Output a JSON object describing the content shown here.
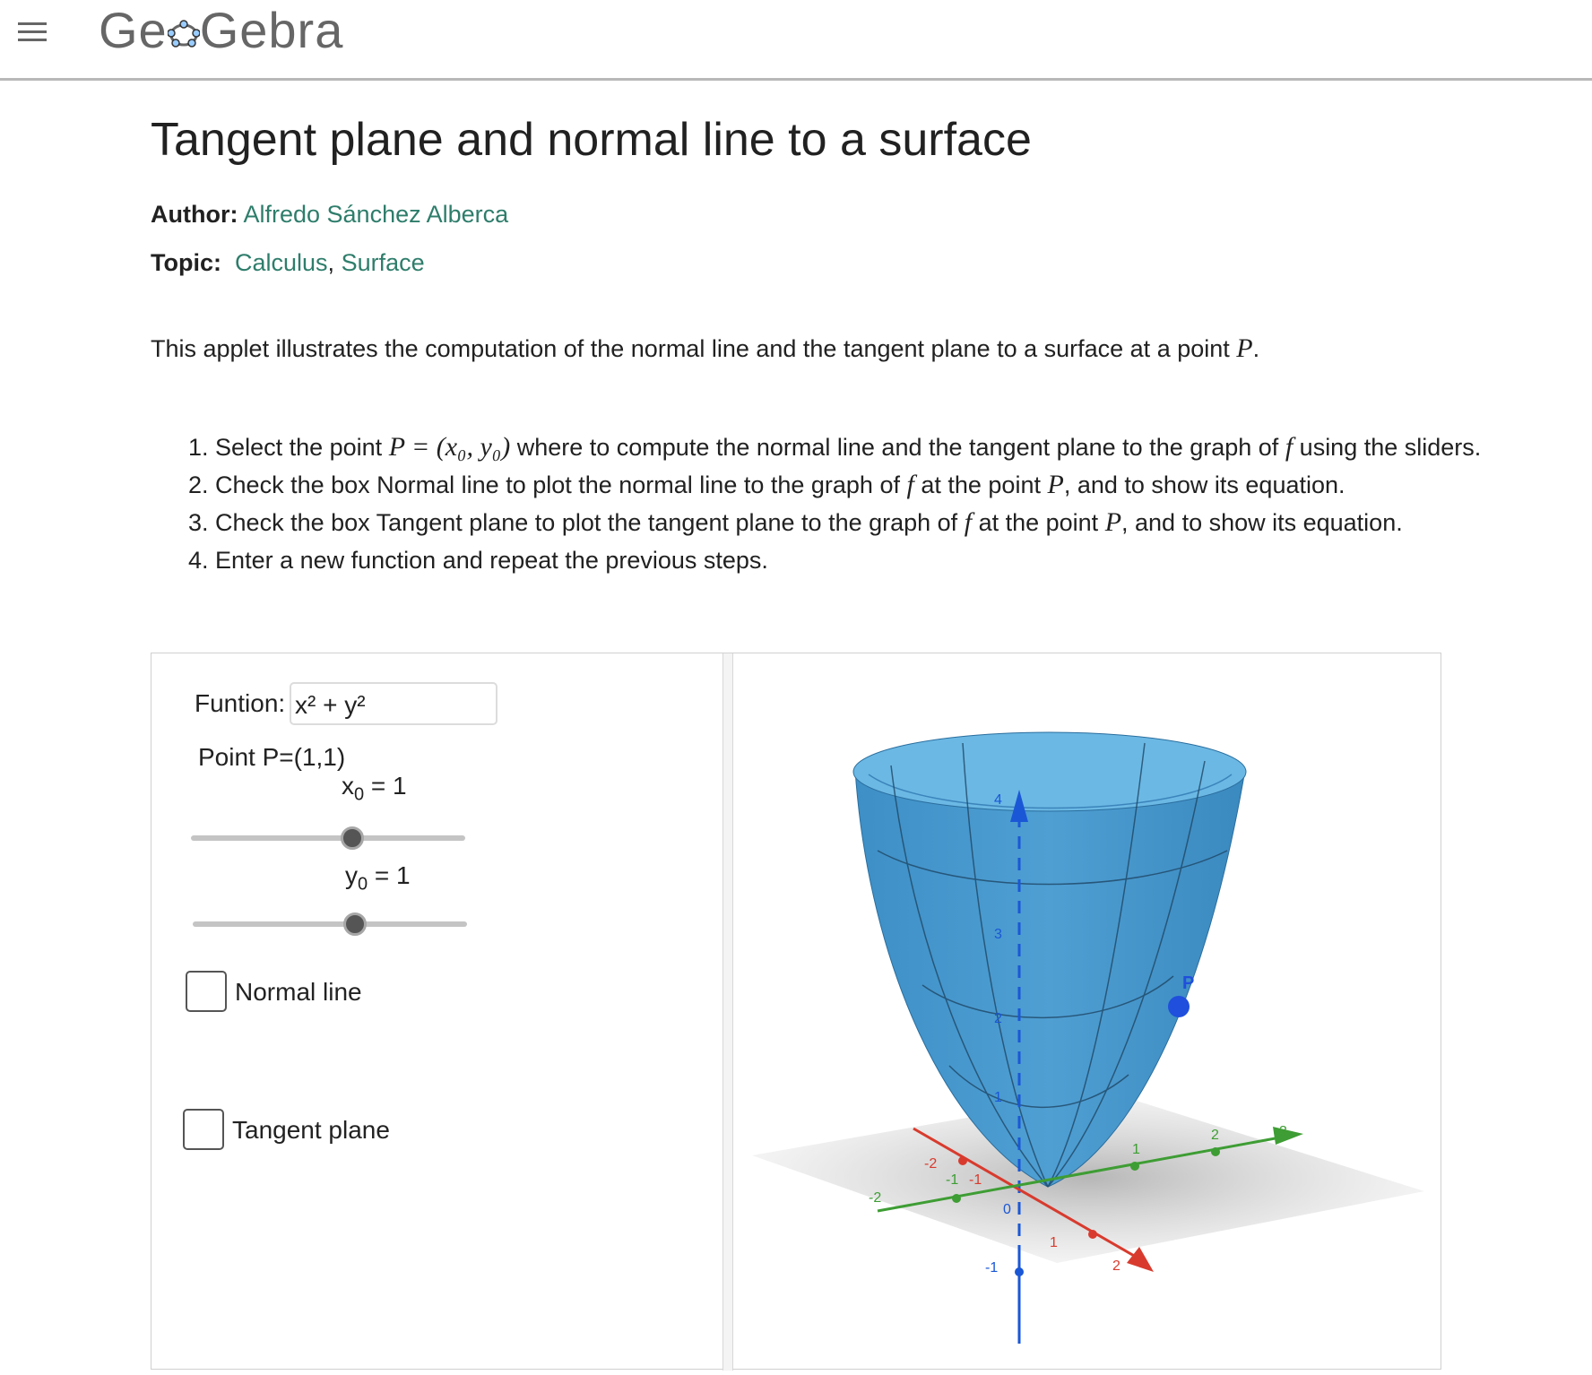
{
  "header": {
    "logo_text": "GeoGebra",
    "logo_left": "Ge",
    "logo_right": "Gebra"
  },
  "page": {
    "title": "Tangent plane and normal line to a surface",
    "author_label": "Author:",
    "author_name": "Alfredo Sánchez Alberca",
    "topic_label": "Topic:",
    "topics": [
      "Calculus",
      "Surface"
    ],
    "topic_separator": ",",
    "intro_text": "This applet illustrates the computation of the normal line and the tangent plane to a surface at a point",
    "intro_math": "P",
    "intro_end": "."
  },
  "steps": [
    {
      "num": "1.",
      "t1": "Select the point",
      "m1": "P = (x₀, y₀)",
      "t2": "where to compute the normal line and the tangent plane to the graph of",
      "m2": "f",
      "t3": "using the sliders."
    },
    {
      "num": "2.",
      "t1": "Check the box Normal line to plot the normal line to the graph of",
      "m1": "f",
      "t2": "at the point",
      "m2": "P",
      "t3": ", and to show its equation."
    },
    {
      "num": "3.",
      "t1": "Check the box Tangent plane to plot the tangent plane to the graph of",
      "m1": "f",
      "t2": "at the point",
      "m2": "P",
      "t3": ", and to show its equation."
    },
    {
      "num": "4.",
      "t1": "Enter a new function and repeat the previous steps.",
      "m1": "",
      "t2": "",
      "m2": "",
      "t3": ""
    }
  ],
  "applet": {
    "function_label": "Funtion:",
    "function_value": "x² + y²",
    "point_label": "Point P=(1,1)",
    "x0": {
      "var": "x",
      "sub": "0",
      "text": " = 1",
      "value": 1
    },
    "y0": {
      "var": "y",
      "sub": "0",
      "text": " = 1",
      "value": 1
    },
    "normal_line": {
      "label": "Normal line",
      "checked": false
    },
    "tangent_plane": {
      "label": "Tangent plane",
      "checked": false
    },
    "point_name": "P",
    "colors": {
      "surface": "#4f9fd3",
      "surface_top": "#6bb8e4",
      "x_axis": "#d83b2e",
      "y_axis": "#3e9d34",
      "z_axis": "#1a57d6",
      "point": "#1f4fdc"
    },
    "axis_ticks": {
      "z": [
        "4",
        "3",
        "2",
        "1",
        "0",
        "-1"
      ],
      "y": [
        "-2",
        "-1",
        "1",
        "2",
        "3"
      ],
      "x": [
        "-2",
        "-1",
        "1",
        "2"
      ]
    }
  }
}
